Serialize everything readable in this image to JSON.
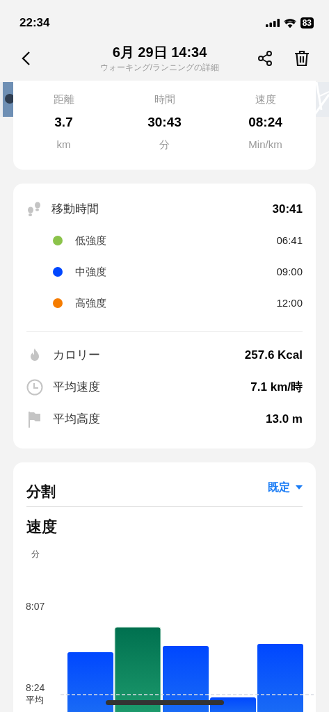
{
  "status_bar": {
    "time": "22:34",
    "battery": "83"
  },
  "header": {
    "title": "6月 29日 14:34",
    "subtitle": "ウォーキング/ランニングの詳細"
  },
  "summary": [
    {
      "label": "距離",
      "value": "3.7",
      "unit": "km"
    },
    {
      "label": "時間",
      "value": "30:43",
      "unit": "分"
    },
    {
      "label": "速度",
      "value": "08:24",
      "unit": "Min/km"
    }
  ],
  "moving_time": {
    "label": "移動時間",
    "value": "30:41",
    "zones": [
      {
        "label": "低強度",
        "value": "06:41",
        "color": "#8bc34a"
      },
      {
        "label": "中強度",
        "value": "09:00",
        "color": "#0047ff"
      },
      {
        "label": "高強度",
        "value": "12:00",
        "color": "#f57c00"
      }
    ]
  },
  "stats": [
    {
      "kind": "calories",
      "label": "カロリー",
      "value": "257.6 Kcal"
    },
    {
      "kind": "speed",
      "label": "平均速度",
      "value": "7.1 km/時"
    },
    {
      "kind": "altitude",
      "label": "平均高度",
      "value": "13.0 m"
    }
  ],
  "splits": {
    "title": "分割",
    "filter": "既定",
    "chart_title": "速度",
    "average_label": "平均",
    "bars": [
      {
        "selected": false
      },
      {
        "selected": true
      },
      {
        "selected": false
      },
      {
        "selected": false
      },
      {
        "selected": false
      }
    ],
    "axis_unit": "分",
    "axis_labels": [
      "8:07",
      "8:24"
    ]
  }
}
